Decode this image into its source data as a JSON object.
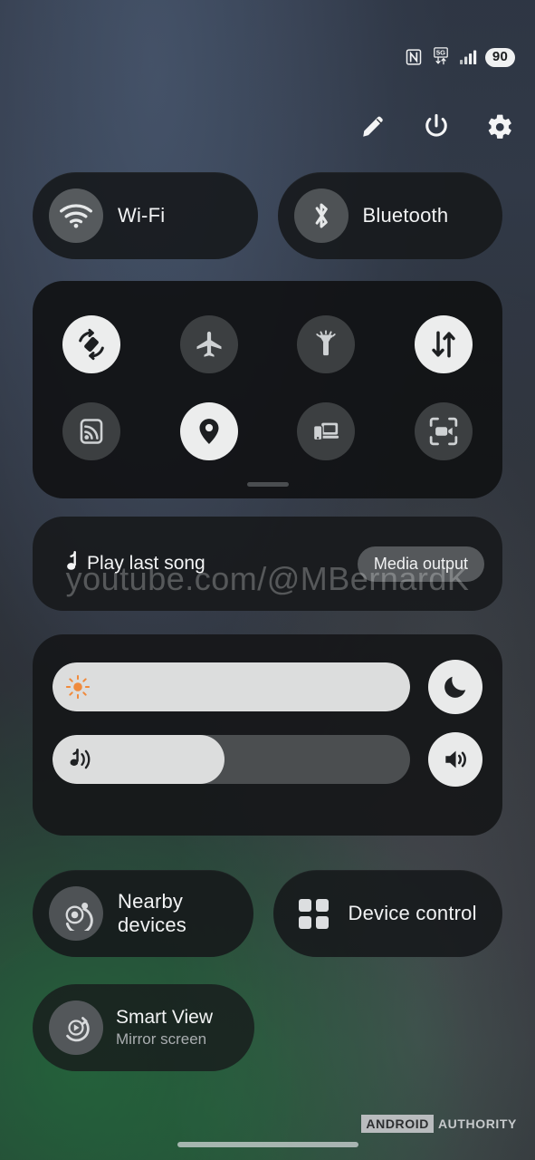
{
  "statusbar": {
    "icons": [
      {
        "name": "nfc-icon",
        "label": "NFC"
      },
      {
        "name": "network-5g-icon",
        "label": "5G"
      },
      {
        "name": "signal-bars-icon",
        "label": "Signal"
      }
    ],
    "battery": "90"
  },
  "header": {
    "actions": [
      {
        "name": "edit-button",
        "label": "Edit"
      },
      {
        "name": "power-button",
        "label": "Power"
      },
      {
        "name": "settings-button",
        "label": "Settings"
      }
    ]
  },
  "top_toggles": [
    {
      "name": "wifi-tile",
      "label": "Wi-Fi",
      "icon": "wifi-icon",
      "state": "off"
    },
    {
      "name": "bluetooth-tile",
      "label": "Bluetooth",
      "icon": "bluetooth-icon",
      "state": "off"
    }
  ],
  "quick_tiles": {
    "row1": [
      {
        "name": "auto-rotate-tile",
        "icon": "auto-rotate-icon",
        "state": "on"
      },
      {
        "name": "airplane-mode-tile",
        "icon": "airplane-icon",
        "state": "off"
      },
      {
        "name": "flashlight-tile",
        "icon": "flashlight-icon",
        "state": "off"
      },
      {
        "name": "mobile-data-tile",
        "icon": "mobile-data-icon",
        "state": "on"
      }
    ],
    "row2": [
      {
        "name": "hotspot-tile",
        "icon": "hotspot-icon",
        "state": "off"
      },
      {
        "name": "location-tile",
        "icon": "location-pin-icon",
        "state": "on"
      },
      {
        "name": "link-to-windows-tile",
        "icon": "multi-device-icon",
        "state": "off"
      },
      {
        "name": "screen-recorder-tile",
        "icon": "screen-recorder-icon",
        "state": "off"
      }
    ]
  },
  "media": {
    "icon": "music-note-icon",
    "title": "Play last song",
    "output_button": "Media output"
  },
  "sliders": {
    "brightness": {
      "name": "brightness-slider",
      "icon": "sun-icon",
      "value": 100,
      "accent": "#f08a3c",
      "button": {
        "name": "dark-mode-button",
        "icon": "moon-icon"
      }
    },
    "volume": {
      "name": "volume-slider",
      "icon": "music-volume-icon",
      "value": 48,
      "button": {
        "name": "sound-mode-button",
        "icon": "speaker-icon"
      }
    }
  },
  "bottom_tiles": [
    {
      "name": "nearby-devices-tile",
      "label": "Nearby devices",
      "icon": "nearby-devices-icon"
    },
    {
      "name": "device-control-tile",
      "label": "Device control",
      "icon": "dot-grid-icon"
    }
  ],
  "smart_view": {
    "name": "smart-view-tile",
    "title": "Smart View",
    "subtitle": "Mirror screen",
    "icon": "smart-view-icon"
  },
  "watermarks": {
    "youtube": "youtube.com/@MBernardK",
    "brand_primary": "ANDROID",
    "brand_secondary": "AUTHORITY"
  }
}
